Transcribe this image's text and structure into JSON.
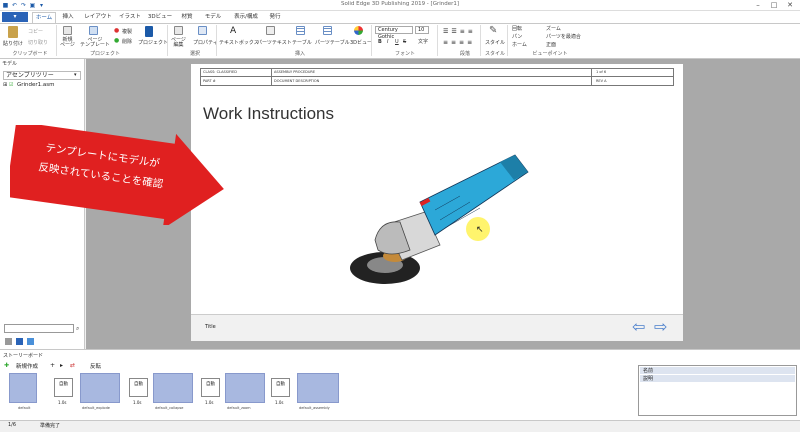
{
  "window": {
    "title": "Solid Edge 3D Publishing 2019 - [Grinder1]",
    "controls": {
      "minimize": "–",
      "maximize": "□",
      "close": "✕"
    }
  },
  "quick_access": [
    "save",
    "undo",
    "redo",
    "print",
    "options"
  ],
  "app_menu": {
    "label": "▾"
  },
  "tabs": [
    "ホーム",
    "挿入",
    "レイアウト",
    "イラスト",
    "3Dビュー",
    "材質",
    "モデル",
    "表示/構成",
    "発行"
  ],
  "ribbon": {
    "clipboard": {
      "paste": "貼り付け",
      "copy": "コピー",
      "cut": "切り取り",
      "group": "クリップボード"
    },
    "project": {
      "new_page": "新規\nページ",
      "page_template": "ページ\nテンプレート",
      "duplicate": "複製",
      "delete": "削除",
      "project": "プロジェクト",
      "group": "プロジェクト"
    },
    "select": {
      "page_edit": "ページ\n編集",
      "properties": "プロパティ",
      "group": "選択"
    },
    "insert": {
      "textbox": "テキストボックス",
      "parts_text": "パーツテキスト",
      "table": "テーブル",
      "parts_table": "パーツテーブル",
      "view3d": "3Dビュー",
      "group": "挿入"
    },
    "font": {
      "family": "Century Gothic",
      "size": "10",
      "text": "文字",
      "bold": "B",
      "italic": "I",
      "underline": "U",
      "strike": "S",
      "group": "フォント"
    },
    "paragraph": {
      "group": "段落"
    },
    "style": {
      "label": "スタイル",
      "group": "スタイル"
    },
    "viewpoint": {
      "rotate": "回転",
      "pan": "パン",
      "home": "ホーム",
      "zoom": "ズーム",
      "fit": "パーツを最適合",
      "front": "正面",
      "group": "ビューポイント"
    }
  },
  "left_panel": {
    "title": "モデル",
    "tree_mode": "アセンブリツリー",
    "item": "Grinder1.asm"
  },
  "document": {
    "header": {
      "class_label": "CLASS: CLASSIFIED",
      "procedure": "ASSEMBLY PROCEDURE",
      "page": "1 of 6",
      "part": "PART #",
      "description": "DOCUMENT DESCRIPTION",
      "rev": "REV A"
    },
    "title": "Work Instructions",
    "footer_title": "Title"
  },
  "annotation": {
    "line1": "テンプレートにモデルが",
    "line2": "反映されていることを確認"
  },
  "storyboard": {
    "title": "ストーリーボード",
    "create_new": "新規作成",
    "invert": "反転",
    "frames": [
      {
        "name": "default",
        "time": "1.0s"
      },
      {
        "name": "default_explode",
        "time": "1.0s"
      },
      {
        "name": "default_collapse",
        "time": "1.0s"
      },
      {
        "name": "default_zoom",
        "time": "1.0s"
      },
      {
        "name": "default_assembly",
        "time": "1.0s"
      }
    ],
    "transitions": [
      "自動",
      "自動",
      "自動",
      "自動"
    ]
  },
  "properties": {
    "name": "名前",
    "description": "説明"
  },
  "status": {
    "page": "1/6",
    "state": "準備完了"
  },
  "colors": {
    "accent": "#2a63b7",
    "arrow": "#e02020",
    "grinder_body": "#2ca8d8",
    "nav_arrow": "#4a7fcc"
  }
}
